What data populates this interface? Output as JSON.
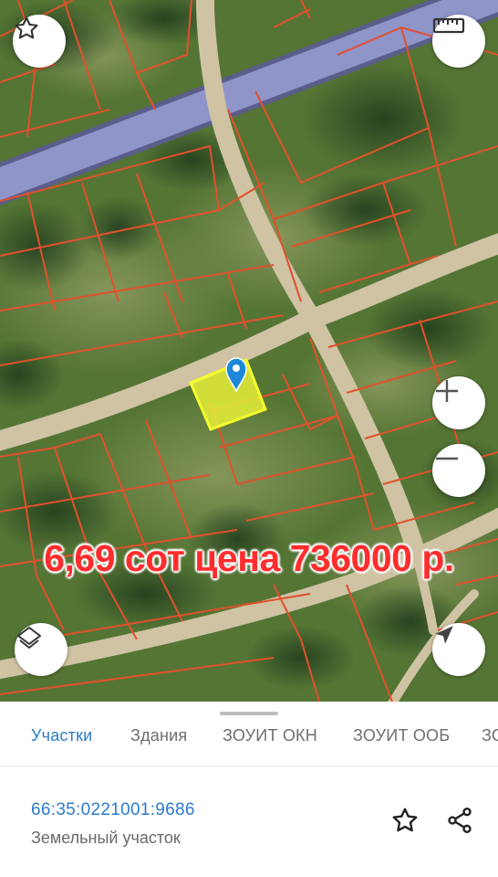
{
  "map": {
    "overlay_text": "6,69 сот цена 736000 р.",
    "colors": {
      "parcel_border": "#e2502c",
      "selected_fill": "#e6f03a",
      "road": "#cfc3a3",
      "highway": "#8f94c9",
      "vegetation": "#4f6f33"
    },
    "controls": {
      "favorite": "star-icon",
      "ruler": "ruler-icon",
      "zoom_in": "plus-icon",
      "zoom_out": "minus-icon",
      "layers": "layers-icon",
      "locate": "navigation-arrow-icon",
      "pin": "location-pin-icon"
    }
  },
  "sheet": {
    "tabs": [
      {
        "label": "Участки",
        "active": true
      },
      {
        "label": "Здания",
        "active": false
      },
      {
        "label": "ЗОУИТ ОКН",
        "active": false
      },
      {
        "label": "ЗОУИТ ООБ",
        "active": false
      },
      {
        "label": "ЗО",
        "active": false
      }
    ],
    "parcel": {
      "number": "66:35:0221001:9686",
      "type": "Земельный участок"
    },
    "actions": {
      "favorite": "star-outline-icon",
      "share": "share-icon"
    },
    "accent_color": "#2b7cc8"
  }
}
